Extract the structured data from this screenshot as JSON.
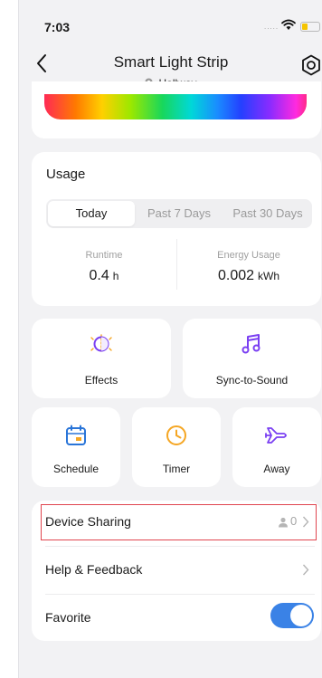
{
  "status": {
    "time": "7:03",
    "signal": "....."
  },
  "header": {
    "title": "Smart Light Strip",
    "location": "Hallway"
  },
  "usage": {
    "title": "Usage",
    "tabs": [
      {
        "label": "Today",
        "active": true
      },
      {
        "label": "Past 7 Days",
        "active": false
      },
      {
        "label": "Past 30 Days",
        "active": false
      }
    ],
    "runtime": {
      "label": "Runtime",
      "value": "0.4",
      "unit": "h"
    },
    "energy": {
      "label": "Energy Usage",
      "value": "0.002",
      "unit": "kWh"
    }
  },
  "features": {
    "effects": "Effects",
    "sync": "Sync-to-Sound",
    "schedule": "Schedule",
    "timer": "Timer",
    "away": "Away"
  },
  "settings": {
    "sharing": {
      "label": "Device Sharing",
      "count": "0"
    },
    "help": {
      "label": "Help & Feedback"
    },
    "favorite": {
      "label": "Favorite",
      "enabled": true
    }
  },
  "colors": {
    "accent": "#3a82e6",
    "icon_purple": "#7a3ff2",
    "icon_blue": "#2a75d8",
    "icon_yellow": "#f5a623",
    "highlight": "#e0454f"
  }
}
